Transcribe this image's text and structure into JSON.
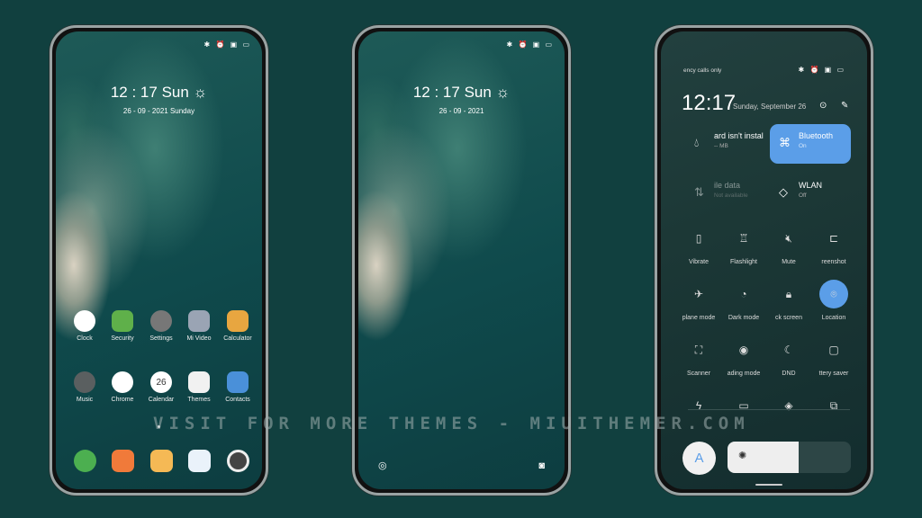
{
  "lock1": {
    "status_icons": "✱ ⏰ ▣ ▭",
    "time": "12 : 17",
    "day": "Sun",
    "weather_icon": "sun-icon",
    "date": "26 - 09 - 2021 Sunday"
  },
  "lock2": {
    "status_icons": "✱ ⏰ ▣ ▭",
    "time": "12 : 17",
    "day": "Sun",
    "date": "26 - 09 - 2021"
  },
  "apps": [
    {
      "label": "Clock",
      "color": "#ffffff"
    },
    {
      "label": "Security",
      "color": "#5fb04a"
    },
    {
      "label": "Settings",
      "color": "#777777"
    },
    {
      "label": "Mi Video",
      "color": "#9aa4b4"
    },
    {
      "label": "Calculator",
      "color": "#e8a640"
    },
    {
      "label": "Music",
      "color": "#5a5f60"
    },
    {
      "label": "Chrome",
      "color": "#ffffff"
    },
    {
      "label": "Calendar",
      "color": "#ffffff",
      "text": "26"
    },
    {
      "label": "Themes",
      "color": "#f1f1f1"
    },
    {
      "label": "Contacts",
      "color": "#4a90d9"
    }
  ],
  "dock": [
    {
      "name": "phone",
      "color": "#4caf50"
    },
    {
      "name": "messages",
      "color": "#f07a3a"
    },
    {
      "name": "notes",
      "color": "#f5b955"
    },
    {
      "name": "gallery",
      "color": "#eaf2fa"
    },
    {
      "name": "camera",
      "color": "#444444"
    }
  ],
  "control": {
    "status_text": "ency calls only",
    "status_icons": "✱ ⏰ ▣ ▭",
    "time": "12:17",
    "date": "Sunday, September 26",
    "tiles": [
      {
        "title": "ard isn't instal",
        "sub": "-- MB",
        "active": false
      },
      {
        "title": "Bluetooth",
        "sub": "On",
        "active": true
      },
      {
        "title": "ile data",
        "sub": "Not available",
        "active": false
      },
      {
        "title": "WLAN",
        "sub": "Off",
        "active": false
      }
    ],
    "toggles": [
      {
        "label": "Vibrate",
        "icon": "▯"
      },
      {
        "label": "Flashlight",
        "icon": "♖"
      },
      {
        "label": "Mute",
        "icon": "🔇︎"
      },
      {
        "label": "reenshot",
        "icon": "⊏"
      },
      {
        "label": "plane mode",
        "icon": "✈"
      },
      {
        "label": "Dark mode",
        "icon": "◔"
      },
      {
        "label": "ck screen",
        "icon": "🔒︎"
      },
      {
        "label": "Location",
        "icon": "⌾",
        "active": true
      },
      {
        "label": "Scanner",
        "icon": "⛶"
      },
      {
        "label": "ading mode",
        "icon": "◉"
      },
      {
        "label": "DND",
        "icon": "☾"
      },
      {
        "label": "ttery saver",
        "icon": "▢"
      },
      {
        "label": "",
        "icon": "ϟ"
      },
      {
        "label": "",
        "icon": "▭"
      },
      {
        "label": "",
        "icon": "◈"
      },
      {
        "label": "",
        "icon": "⧉"
      }
    ],
    "auto_brightness": "A",
    "brightness_percent": 58
  },
  "accent": "#5b9ee8",
  "watermark": "VISIT FOR MORE THEMES - MIUITHEMER.COM"
}
